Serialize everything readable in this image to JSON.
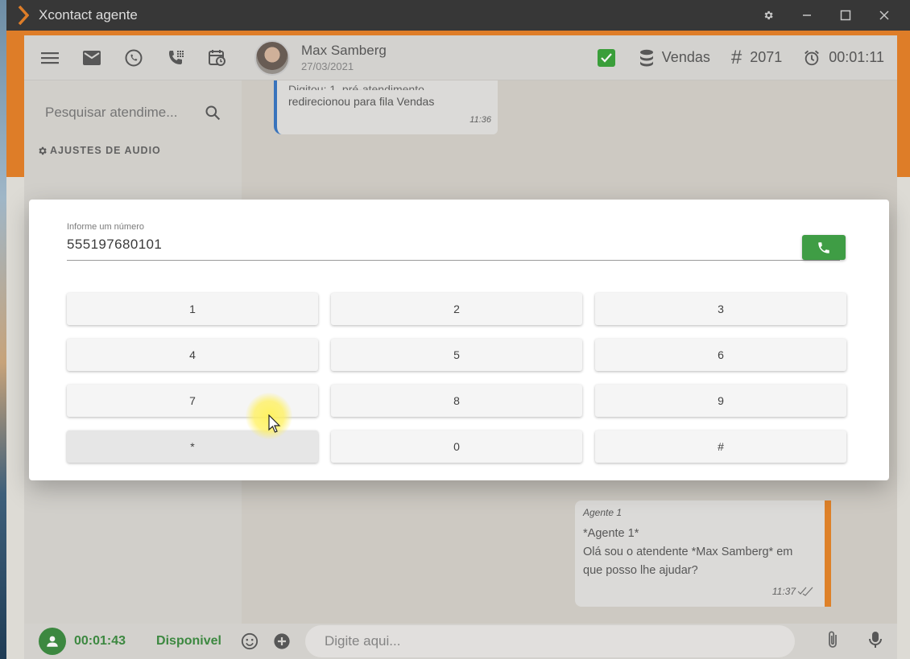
{
  "window": {
    "title": "Xcontact agente"
  },
  "toolbar": {
    "contact_name": "Max Samberg",
    "contact_date": "27/03/2021",
    "queue": "Vendas",
    "hash_symbol": "#",
    "extension": "2071",
    "call_timer": "00:01:11"
  },
  "sidebar": {
    "search_placeholder": "Pesquisar atendime...",
    "audio_settings": "AJUSTES DE AUDIO"
  },
  "chat": {
    "incoming": {
      "cut_text": "Digitou: 1, pré-atendimento",
      "text": "redirecionou para fila Vendas",
      "time": "11:36"
    },
    "outgoing": {
      "author": "Agente 1",
      "lines": [
        "*Agente 1*",
        "Olá sou o atendente *Max Samberg* em",
        "que posso lhe ajudar?"
      ],
      "time": "11:37"
    }
  },
  "dialer": {
    "label": "Informe um número",
    "number": "555197680101",
    "keys": [
      "1",
      "2",
      "3",
      "4",
      "5",
      "6",
      "7",
      "8",
      "9",
      "*",
      "0",
      "#"
    ]
  },
  "bottombar": {
    "timer": "00:01:43",
    "status": "Disponivel",
    "message_placeholder": "Digite aqui..."
  },
  "colors": {
    "orange": "#e8832a",
    "green": "#3f9d45",
    "blue": "#3b78c4"
  }
}
